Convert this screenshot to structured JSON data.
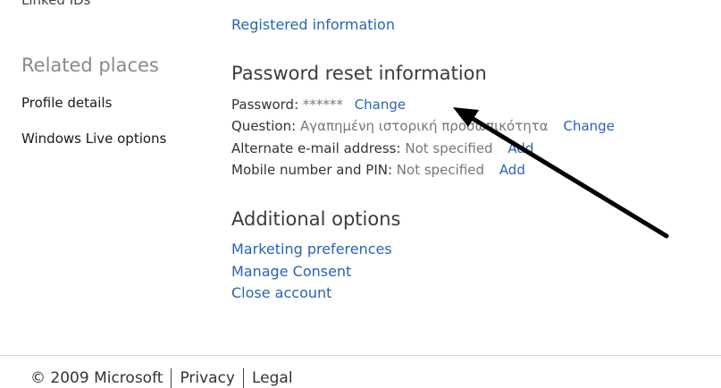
{
  "sidebar": {
    "linked_ids_cut": "Linked IDs",
    "related_heading": "Related places",
    "items": [
      {
        "label": "Profile details"
      },
      {
        "label": "Windows Live options"
      }
    ]
  },
  "main": {
    "registered_information": "Registered information",
    "password_reset": {
      "heading": "Password reset information",
      "password_label": "Password:",
      "password_value": "******",
      "password_change": "Change",
      "question_label": "Question:",
      "question_value": "Αγαπημένη ιστορική προσωπικότητα",
      "question_change": "Change",
      "alt_email_label": "Alternate e-mail address:",
      "alt_email_value": "Not specified",
      "alt_email_add": "Add",
      "mobile_label": "Mobile number and PIN:",
      "mobile_value": "Not specified",
      "mobile_add": "Add"
    },
    "additional": {
      "heading": "Additional options",
      "links": [
        {
          "label": "Marketing preferences"
        },
        {
          "label": "Manage Consent"
        },
        {
          "label": "Close account"
        }
      ]
    }
  },
  "footer": {
    "copyright": "© 2009 Microsoft",
    "privacy": "Privacy",
    "legal": "Legal"
  },
  "colors": {
    "link": "#2864b4",
    "annotation_arrow": "#000000"
  }
}
